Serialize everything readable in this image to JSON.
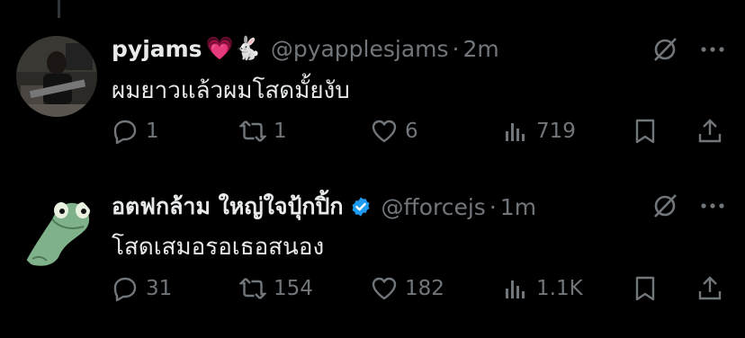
{
  "tweets": [
    {
      "name": "pyjams",
      "emoji": "💗🐇",
      "handle": "@pyapplesjams",
      "separator": "·",
      "time": "2m",
      "text": "ผมยาวแล้วผมโสดมั้ยงับ",
      "verified": false,
      "stats": {
        "replies": "1",
        "reposts": "1",
        "likes": "6",
        "views": "719"
      }
    },
    {
      "name": "อตฟกล้าม ใหญ่ใจปุ้กปิ้ก",
      "emoji": "",
      "handle": "@fforcejs",
      "separator": "·",
      "time": "1m",
      "text": "โสดเสมอรอเธอสนอง",
      "verified": true,
      "stats": {
        "replies": "31",
        "reposts": "154",
        "likes": "182",
        "views": "1.1K"
      }
    }
  ],
  "colors": {
    "background": "#000000",
    "text": "#e7e9ea",
    "muted": "#71767b",
    "verified": "#1d9bf0"
  },
  "icons": [
    "grok-icon",
    "more-icon",
    "reply-icon",
    "repost-icon",
    "like-icon",
    "views-icon",
    "bookmark-icon",
    "share-icon"
  ]
}
